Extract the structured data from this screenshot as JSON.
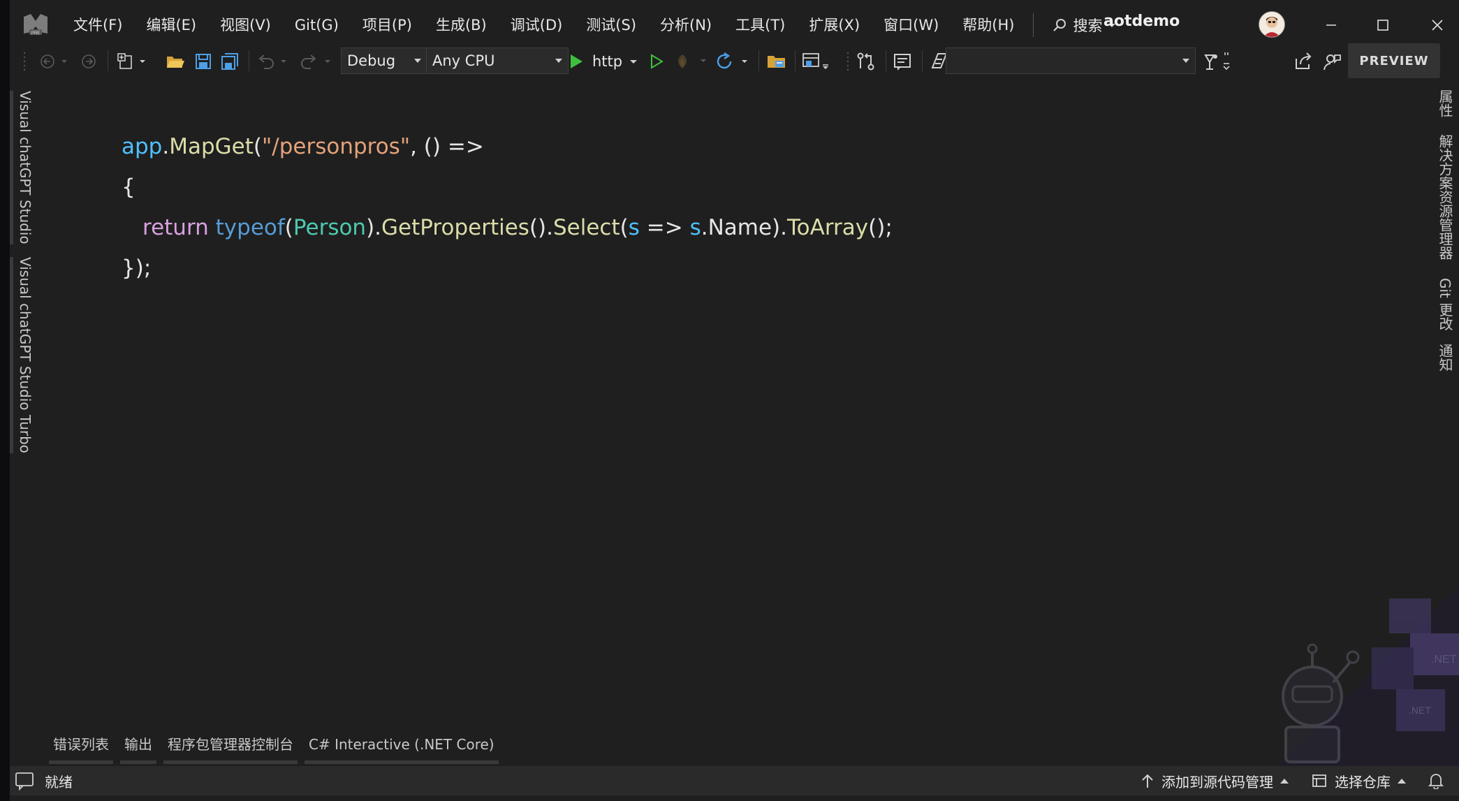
{
  "menu": [
    "文件(F)",
    "编辑(E)",
    "视图(V)",
    "Git(G)",
    "项目(P)",
    "生成(B)",
    "调试(D)",
    "测试(S)",
    "分析(N)",
    "工具(T)",
    "扩展(X)",
    "窗口(W)",
    "帮助(H)"
  ],
  "search_label": "搜索",
  "app_title": "aotdemo",
  "toolbar": {
    "config": "Debug",
    "platform": "Any CPU",
    "run_target": "http",
    "preview": "PREVIEW"
  },
  "left_tabs": [
    "Visual chatGPT Studio",
    "Visual chatGPT Studio Turbo"
  ],
  "right_tabs": [
    "属性",
    "解决方案资源管理器",
    "Git 更改",
    "通知"
  ],
  "code": {
    "line1": {
      "app": "app",
      "dot": ".",
      "method": "MapGet",
      "open": "(",
      "str": "\"/personpros\"",
      "rest": ", () =>"
    },
    "line2": "{",
    "line3": {
      "ret": "return",
      "typeof": "typeof",
      "p1": "(",
      "type": "Person",
      "p2": ").",
      "gp": "GetProperties",
      "p3": "().",
      "sel": "Select",
      "p4": "(",
      "s1": "s",
      "arrow": " => ",
      "s2": "s",
      "name": ".Name).",
      "toarr": "ToArray",
      "end": "();"
    },
    "line4": "});"
  },
  "bottom_tabs": [
    "错误列表",
    "输出",
    "程序包管理器控制台",
    "C# Interactive (.NET Core)"
  ],
  "status": {
    "ready": "就绪",
    "add_source_control": "添加到源代码管理",
    "select_repo": "选择仓库"
  },
  "colors": {
    "background": "#1f1f1f",
    "keyword_purple": "#d8a0df",
    "keyword_blue": "#569cd6",
    "type_teal": "#4ec9b0",
    "method_yellow": "#dcdcaa",
    "string_orange": "#e4a27a",
    "run_green": "#3fbf3f"
  }
}
